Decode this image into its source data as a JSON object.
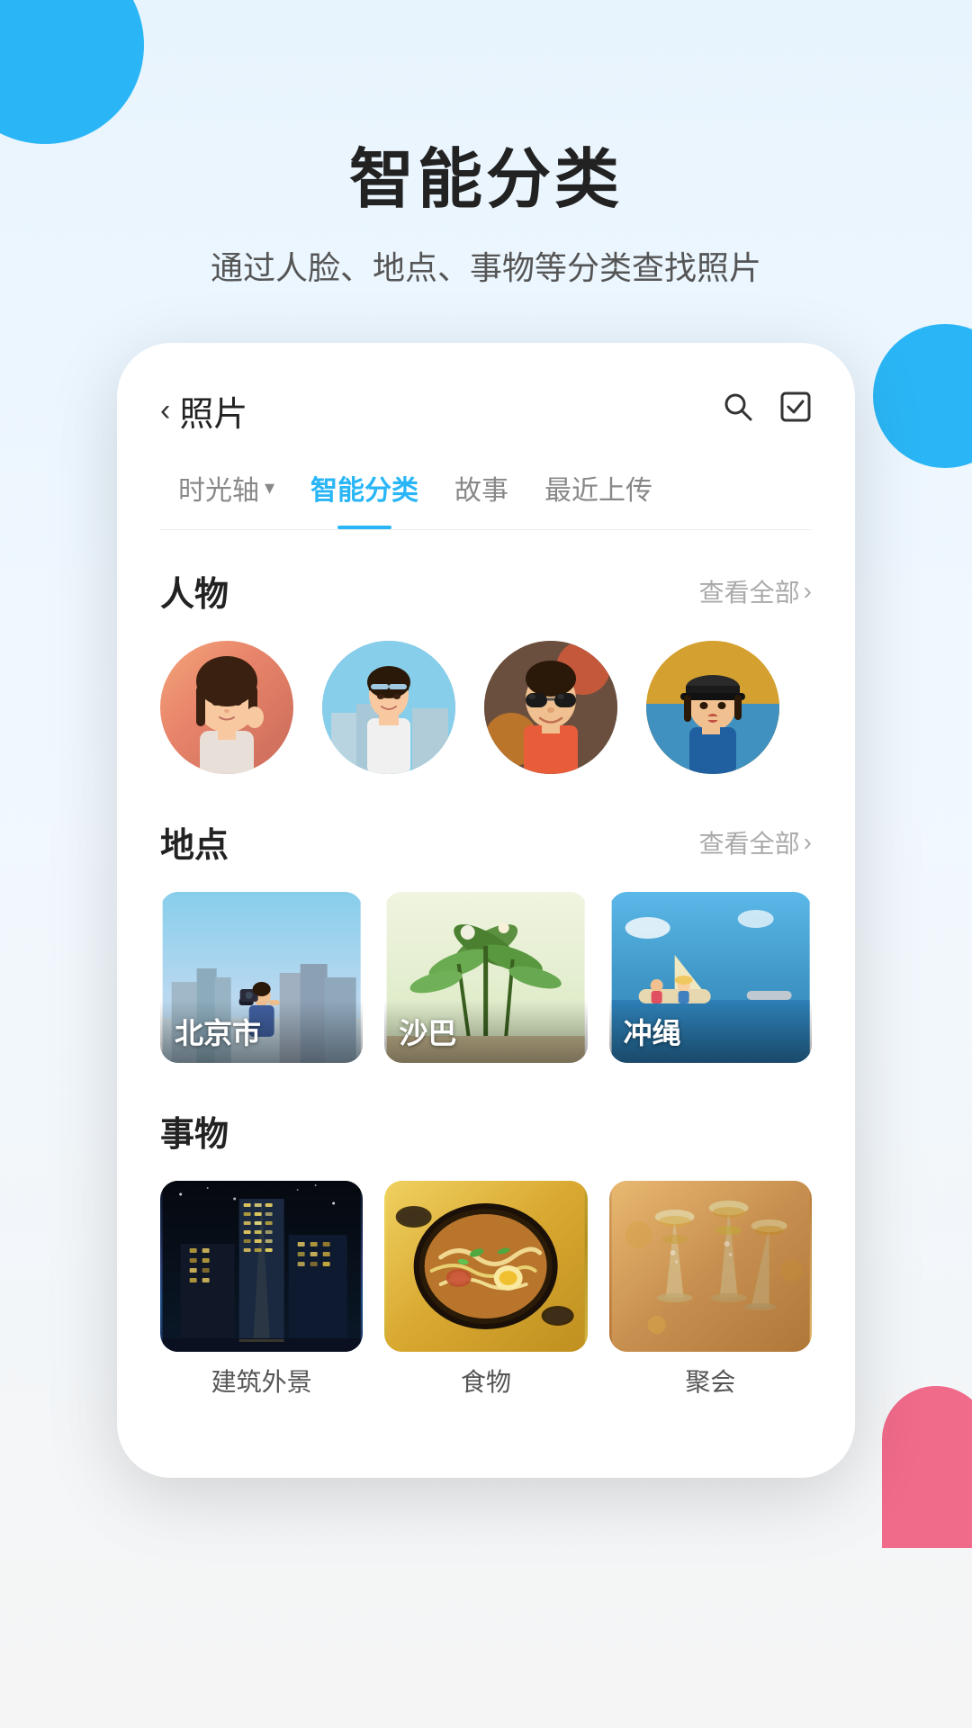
{
  "decorations": {
    "circle_top_left": true,
    "circle_right": true,
    "pink_bottom_right": true
  },
  "header": {
    "main_title": "智能分类",
    "sub_title": "通过人脸、地点、事物等分类查找照片"
  },
  "app": {
    "back_label": "照片",
    "search_icon": "search",
    "select_icon": "check-square",
    "tabs": [
      {
        "id": "timeline",
        "label": "时光轴",
        "has_arrow": true,
        "active": false
      },
      {
        "id": "smart",
        "label": "智能分类",
        "has_arrow": false,
        "active": true
      },
      {
        "id": "story",
        "label": "故事",
        "has_arrow": false,
        "active": false
      },
      {
        "id": "recent",
        "label": "最近上传",
        "has_arrow": false,
        "active": false
      }
    ],
    "sections": {
      "people": {
        "title": "人物",
        "see_all": "查看全部",
        "persons": [
          {
            "id": 1,
            "initials": "",
            "color_class": "avatar-1"
          },
          {
            "id": 2,
            "initials": "",
            "color_class": "avatar-2"
          },
          {
            "id": 3,
            "initials": "",
            "color_class": "avatar-3"
          },
          {
            "id": 4,
            "initials": "",
            "color_class": "avatar-4"
          }
        ]
      },
      "places": {
        "title": "地点",
        "see_all": "查看全部",
        "locations": [
          {
            "id": 1,
            "name": "北京市",
            "color_class": "loc-beijing"
          },
          {
            "id": 2,
            "name": "沙巴",
            "color_class": "loc-shaba"
          },
          {
            "id": 3,
            "name": "冲绳",
            "color_class": "loc-okinawa"
          }
        ]
      },
      "things": {
        "title": "事物",
        "items": [
          {
            "id": 1,
            "name": "建筑外景",
            "color_class": "thing-architecture"
          },
          {
            "id": 2,
            "name": "食物",
            "color_class": "thing-food"
          },
          {
            "id": 3,
            "name": "聚会",
            "color_class": "thing-party"
          }
        ]
      }
    }
  }
}
